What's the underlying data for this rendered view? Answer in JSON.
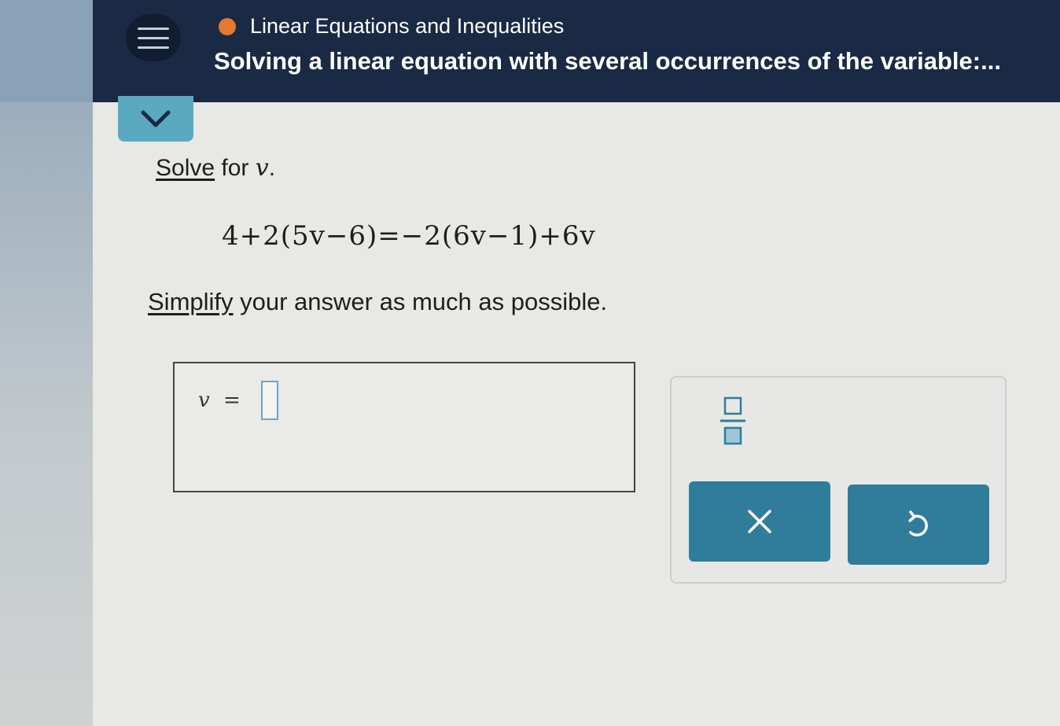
{
  "header": {
    "topic": "Linear Equations and Inequalities",
    "title": "Solving a linear equation with several occurrences of the variable:...",
    "topic_color": "#e4792f",
    "bar_color": "#1a2a44"
  },
  "question": {
    "solve_link": "Solve",
    "solve_rest": "for",
    "variable": "v",
    "period": ".",
    "equation": "4+2(5v−6)=−2(6v−1)+6v",
    "simplify_link": "Simplify",
    "simplify_rest": "your answer as much as possible."
  },
  "answer": {
    "variable": "v",
    "equals": "=",
    "value": "",
    "placeholder": ""
  },
  "keypad": {
    "fraction_icon": "fraction-icon",
    "clear_icon": "close-icon",
    "undo_icon": "undo-icon",
    "accent": "#2f7d9a"
  }
}
